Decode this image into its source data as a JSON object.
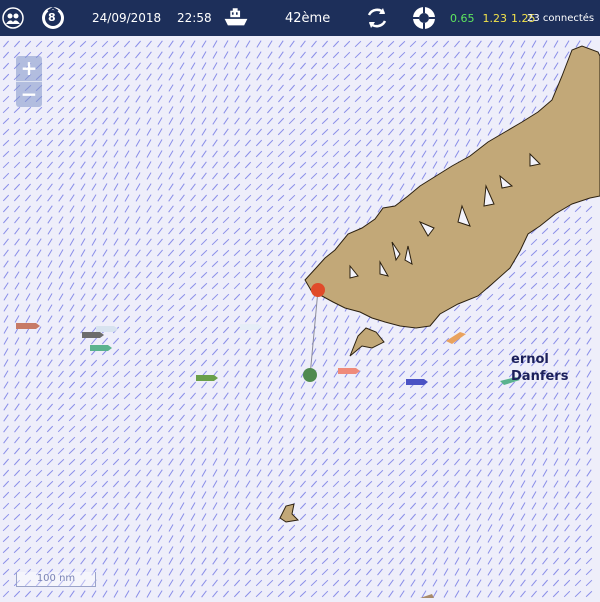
{
  "topbar": {
    "date": "24/09/2018",
    "time": "22:58",
    "rank": "42ème",
    "badge_number": "8",
    "stat_a": "0.65",
    "stat_b": "1.23",
    "stat_c": "1.25",
    "connected": "23 connectés",
    "colors": {
      "bar": "#1d2f5a",
      "stat_a": "#5ee65e",
      "stat_b": "#f2e24a",
      "stat_c": "#f2e24a"
    },
    "icons": [
      "users-icon",
      "badge-icon",
      "boat-icon",
      "refresh-icon",
      "lifebuoy-icon"
    ]
  },
  "map": {
    "zoom_in": "+",
    "zoom_out": "−",
    "scale_label": "100 nm",
    "labels": [
      "ernol",
      "Danfers"
    ],
    "colors": {
      "land": "#c2a878",
      "sea": "#eeeefa",
      "wind_arrow": "#8a8ee8"
    }
  }
}
